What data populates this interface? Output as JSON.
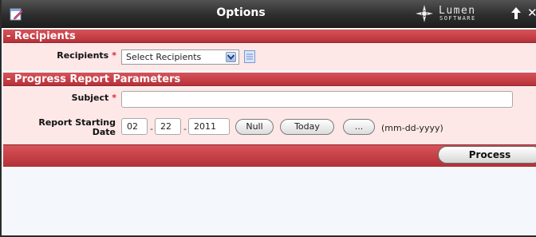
{
  "window": {
    "title": "Options",
    "brand_name": "Lumen",
    "brand_sub": "SOFTWARE",
    "close_glyph": "✕"
  },
  "sections": {
    "recipients": {
      "header": "- Recipients",
      "field_label": "Recipients",
      "required_mark": "*",
      "select_value": "Select Recipients"
    },
    "progress": {
      "header": "- Progress Report Parameters",
      "subject_label": "Subject",
      "subject_value": "",
      "required_mark": "*",
      "date_label_line1": "Report Starting",
      "date_label_line2": "Date",
      "date": {
        "month": "02",
        "day": "22",
        "year": "2011",
        "separator": "-"
      },
      "buttons": {
        "null": "Null",
        "today": "Today",
        "picker": "..."
      },
      "date_format_hint": "(mm-dd-yyyy)"
    }
  },
  "footer": {
    "process_label": "Process"
  },
  "colors": {
    "section_header": "#c83f46",
    "section_body": "#fde7e7",
    "titlebar": "#2e2e2e",
    "required": "#e0262a"
  }
}
